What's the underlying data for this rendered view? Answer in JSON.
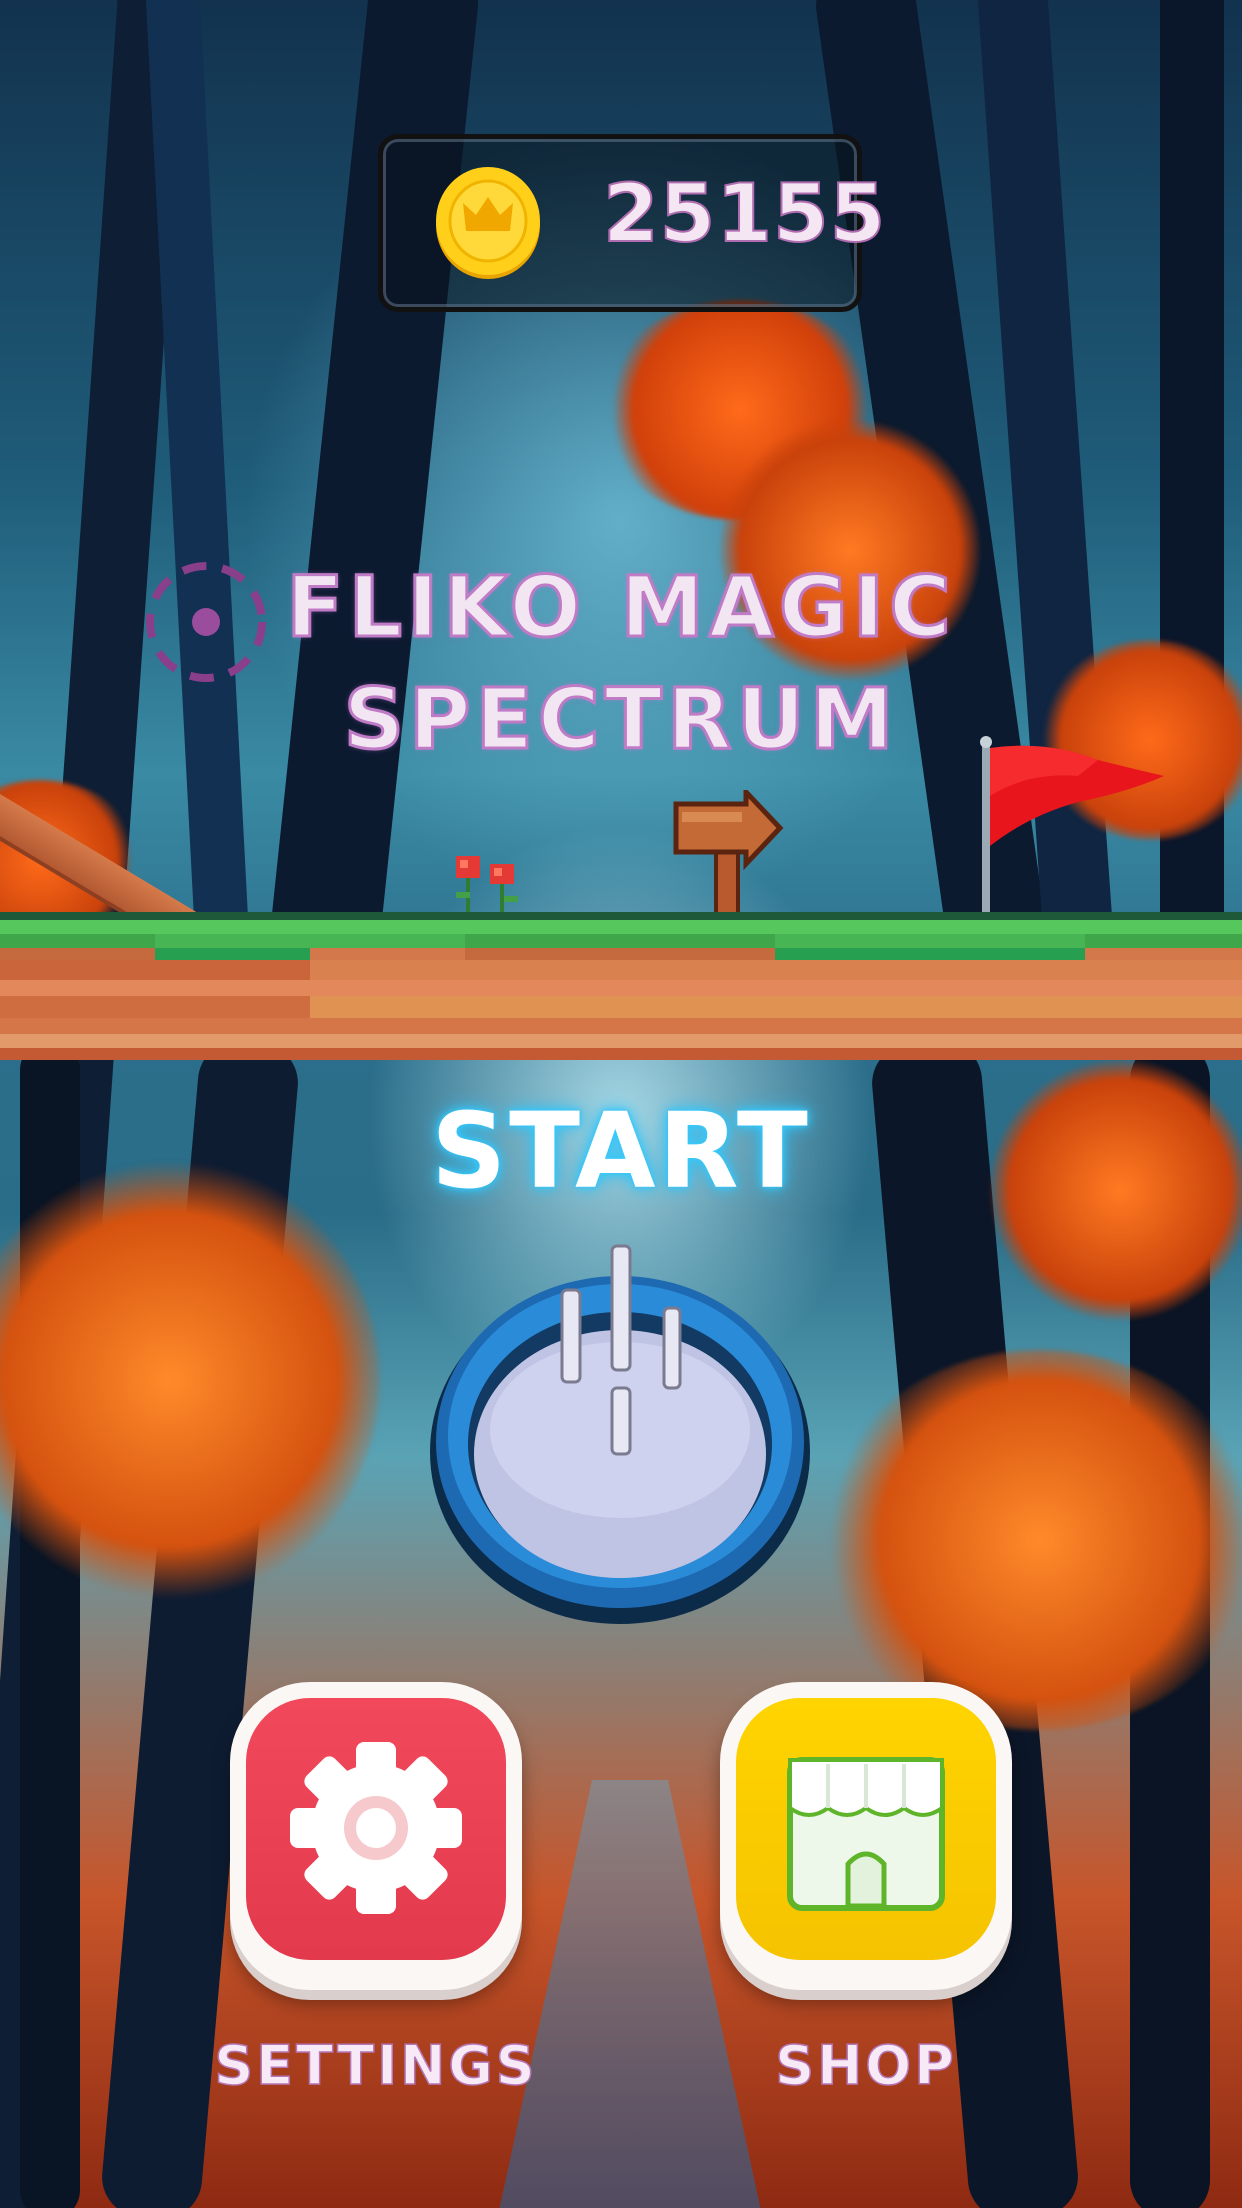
{
  "hud": {
    "coins": "25155",
    "coin_icon": "crown-coin-icon"
  },
  "title": {
    "line1": "FLIKO MAGIC",
    "line2": "SPECTRUM"
  },
  "start": {
    "label": "START",
    "icon": "ring-drop-icon"
  },
  "buttons": {
    "settings": {
      "label": "SETTINGS",
      "icon": "gear-icon",
      "color": "#e8404f"
    },
    "shop": {
      "label": "SHOP",
      "icon": "storefront-icon",
      "color": "#fbcc05"
    }
  },
  "colors": {
    "accent_text": "#c07bc6",
    "start_glow": "#39d0ff"
  }
}
